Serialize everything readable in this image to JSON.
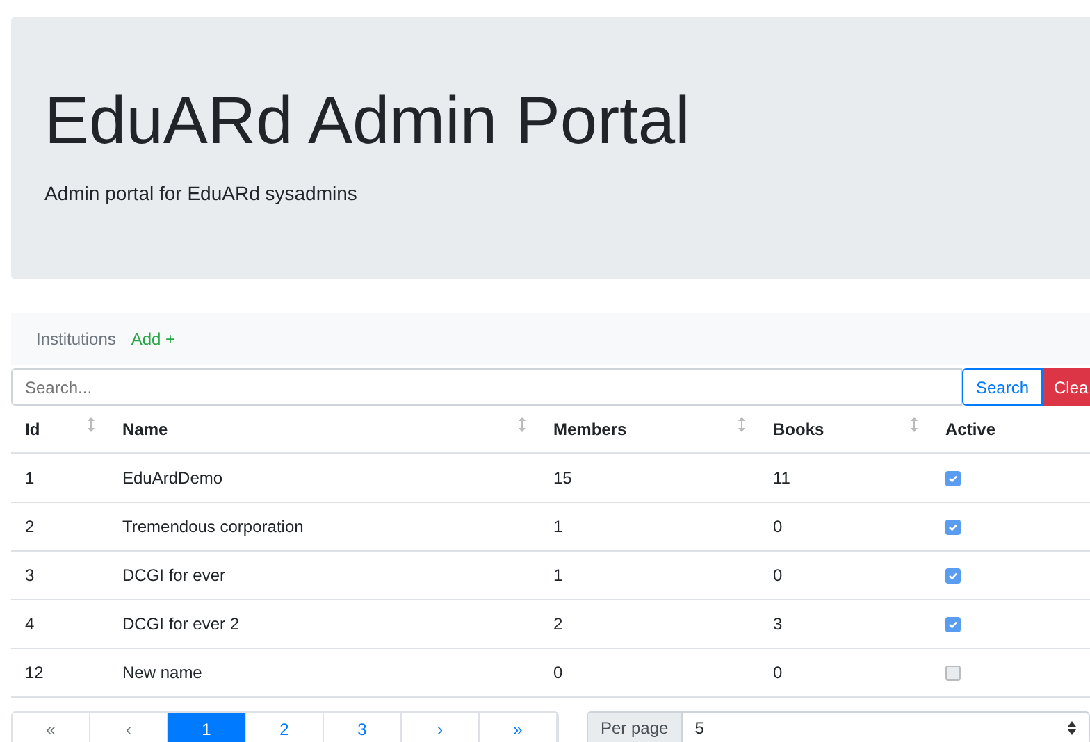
{
  "header": {
    "title": "EduARd Admin Portal",
    "subtitle": "Admin portal for EduARd sysadmins"
  },
  "nav": [
    {
      "label": "Institutions",
      "kind": "text"
    },
    {
      "label": "Add +",
      "kind": "add"
    }
  ],
  "search": {
    "placeholder": "Search...",
    "search_button": "Search",
    "clear_button": "Clea"
  },
  "table": {
    "columns": [
      {
        "label": "Id",
        "sortable": true
      },
      {
        "label": "Name",
        "sortable": true
      },
      {
        "label": "Members",
        "sortable": true
      },
      {
        "label": "Books",
        "sortable": true
      },
      {
        "label": "Active",
        "sortable": false
      }
    ],
    "rows": [
      {
        "id": "1",
        "name": "EduArdDemo",
        "members": "15",
        "books": "11",
        "active": true
      },
      {
        "id": "2",
        "name": "Tremendous corporation",
        "members": "1",
        "books": "0",
        "active": true
      },
      {
        "id": "3",
        "name": "DCGI for ever",
        "members": "1",
        "books": "0",
        "active": true
      },
      {
        "id": "4",
        "name": "DCGI for ever 2",
        "members": "2",
        "books": "3",
        "active": true
      },
      {
        "id": "12",
        "name": "New name",
        "members": "0",
        "books": "0",
        "active": false
      }
    ]
  },
  "pagination": [
    {
      "label": "«",
      "selected": false
    },
    {
      "label": "‹",
      "selected": false
    },
    {
      "label": "1",
      "selected": true
    },
    {
      "label": "2",
      "selected": false
    },
    {
      "label": "3",
      "selected": false
    },
    {
      "label": "›",
      "selected": false
    },
    {
      "label": "»",
      "selected": false
    }
  ],
  "per_page": {
    "label": "Per page",
    "value": "5"
  }
}
